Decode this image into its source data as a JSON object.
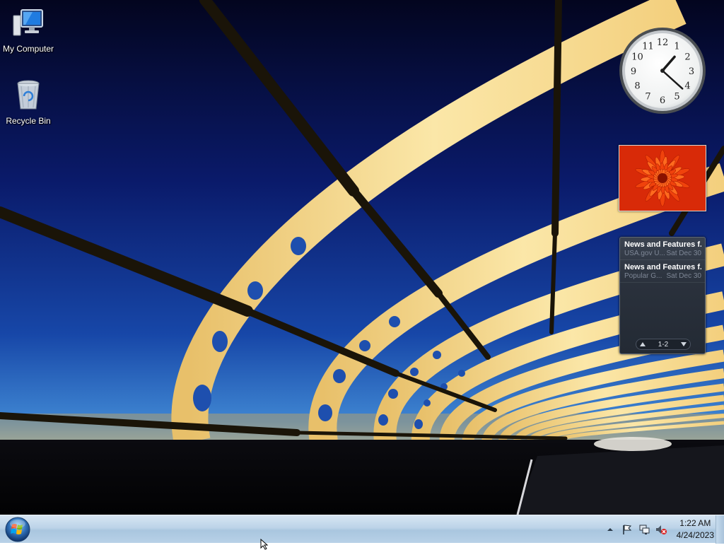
{
  "desktop": {
    "icons": [
      {
        "label": "My Computer",
        "icon": "computer-icon"
      },
      {
        "label": "Recycle Bin",
        "icon": "recycle-bin-icon"
      }
    ]
  },
  "gadgets": {
    "clock": {
      "time": "1:22",
      "numerals": [
        "12",
        "1",
        "2",
        "3",
        "4",
        "5",
        "6",
        "7",
        "8",
        "9",
        "10",
        "11"
      ]
    },
    "slideshow": {
      "image": "orange-flower-photo"
    },
    "feed": {
      "items": [
        {
          "title": "News and Features f...",
          "source": "USA.gov U...",
          "date": "Sat Dec 30"
        },
        {
          "title": "News and Features f...",
          "source": "Popular G...",
          "date": "Sat Dec 30"
        }
      ],
      "range": "1-2"
    }
  },
  "taskbar": {
    "start_icon": "windows-logo-icon",
    "tray": {
      "icons": [
        "show-hidden-icons-arrow-icon",
        "action-center-flag-icon",
        "network-icon",
        "volume-muted-icon"
      ],
      "time": "1:22 AM",
      "date": "4/24/2023"
    }
  },
  "colors": {
    "sky_top": "#05082c",
    "sky_mid": "#0d2f8c",
    "sky_horizon": "#3a7fcf",
    "arch": "#f0d383",
    "taskbar": "#bcd3e8"
  }
}
